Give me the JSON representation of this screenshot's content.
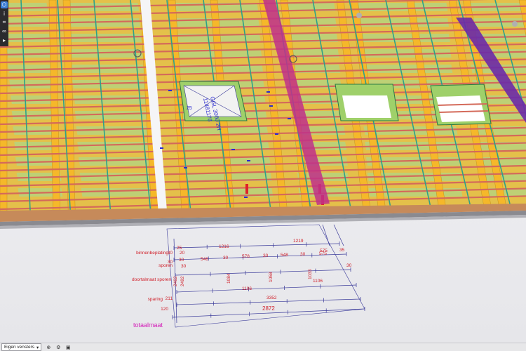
{
  "toolbar": {
    "buttons": [
      {
        "name": "cube-view-icon",
        "glyph": "⬡"
      },
      {
        "name": "info-icon",
        "glyph": "i"
      },
      {
        "name": "measure-icon",
        "glyph": "⌗"
      },
      {
        "name": "link-icon",
        "glyph": "∞"
      },
      {
        "name": "expand-arrow-icon",
        "glyph": "▸"
      }
    ]
  },
  "model": {
    "opening_label_line1": "GGL 3000 2H",
    "opening_label_line2": "11481178",
    "opening_badge": "25"
  },
  "dimensions": {
    "rows": [
      {
        "label": "binnenbeplating",
        "left_value": "30",
        "values": [
          "25",
          "20",
          "1216",
          "1219",
          "575",
          "35"
        ]
      },
      {
        "label": "sporen",
        "left_value": "30",
        "values": [
          "30",
          "546",
          "30",
          "578",
          "30",
          "548",
          "30",
          "575",
          "30",
          "30"
        ]
      },
      {
        "label": "doortalmaat sporen",
        "left_value": "",
        "values": [
          "2462",
          "2492",
          "1084",
          "1058",
          "1033"
        ]
      },
      {
        "label": "sparing",
        "left_value": "211",
        "values": [
          "1106",
          "3352"
        ]
      },
      {
        "label": "",
        "left_value": "120",
        "values": [
          "2872"
        ]
      }
    ],
    "total_label": "totaalmaat"
  },
  "statusbar": {
    "views_label": "Eigen vensters",
    "icons": [
      "add-view-icon",
      "settings-icon",
      "camera-icon"
    ]
  },
  "colors": {
    "beam_yellow": "#f5b82a",
    "panel_green": "#b9d27a",
    "rafter_red": "#d46a5a",
    "batten_teal": "#2fa08a",
    "accent_magenta": "#c0308a",
    "accent_purple": "#6a2aa8",
    "dimension_red": "#d0202a",
    "total_magenta": "#d420b8"
  }
}
